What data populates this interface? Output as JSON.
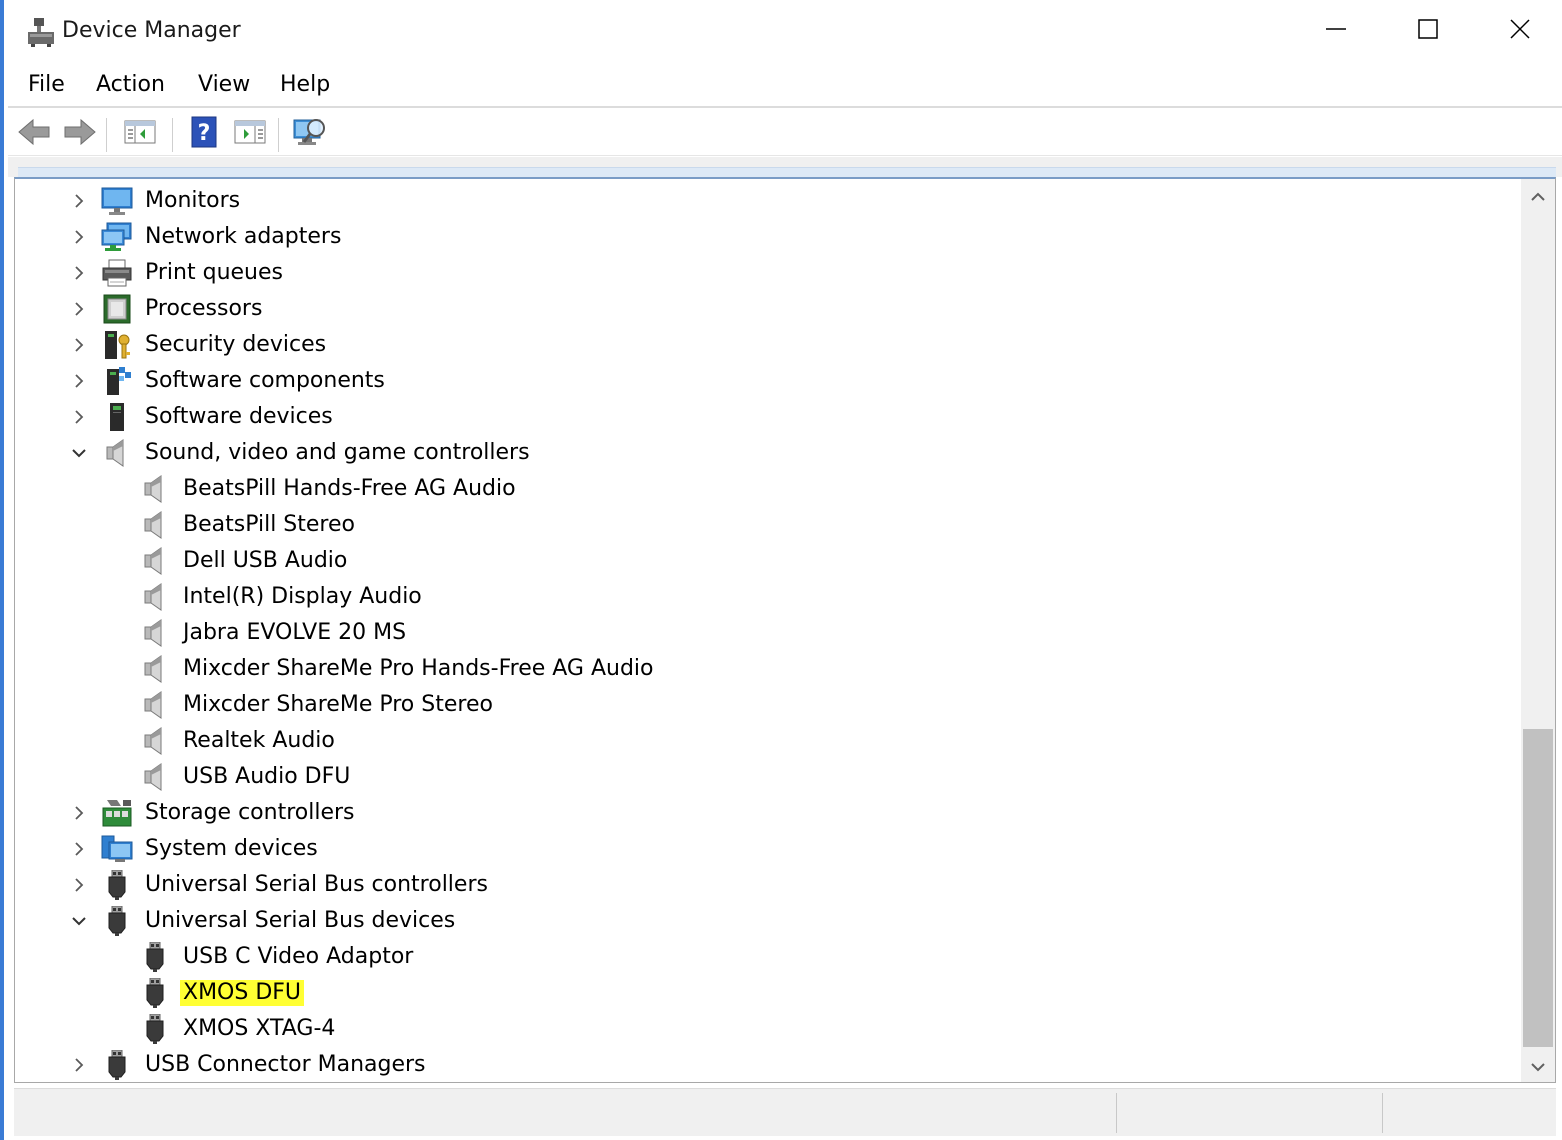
{
  "window": {
    "title": "Device Manager",
    "icon": "device-manager-icon",
    "controls": [
      "minimize-icon",
      "maximize-icon",
      "close-icon"
    ]
  },
  "menu": {
    "file": "File",
    "action": "Action",
    "view": "View",
    "help": "Help"
  },
  "toolbar": {
    "buttons": [
      "back-arrow-icon",
      "forward-arrow-icon",
      "show-hide-console-tree-icon",
      "help-icon",
      "properties-icon",
      "scan-hardware-icon"
    ]
  },
  "tree": {
    "rows": [
      {
        "label": "Monitors",
        "icon": "monitor-icon",
        "expander": "collapsed",
        "level": 1
      },
      {
        "label": "Network adapters",
        "icon": "network-adapter-icon",
        "expander": "collapsed",
        "level": 1
      },
      {
        "label": "Print queues",
        "icon": "printer-icon",
        "expander": "collapsed",
        "level": 1
      },
      {
        "label": "Processors",
        "icon": "processor-icon",
        "expander": "collapsed",
        "level": 1
      },
      {
        "label": "Security devices",
        "icon": "security-device-icon",
        "expander": "collapsed",
        "level": 1
      },
      {
        "label": "Software components",
        "icon": "software-component-icon",
        "expander": "collapsed",
        "level": 1
      },
      {
        "label": "Software devices",
        "icon": "software-device-icon",
        "expander": "collapsed",
        "level": 1
      },
      {
        "label": "Sound, video and game controllers",
        "icon": "speaker-icon",
        "expander": "expanded",
        "level": 1
      },
      {
        "label": "BeatsPill Hands-Free AG Audio",
        "icon": "speaker-icon",
        "level": 2
      },
      {
        "label": "BeatsPill Stereo",
        "icon": "speaker-icon",
        "level": 2
      },
      {
        "label": "Dell USB Audio",
        "icon": "speaker-icon",
        "level": 2
      },
      {
        "label": "Intel(R) Display Audio",
        "icon": "speaker-icon",
        "level": 2
      },
      {
        "label": "Jabra EVOLVE 20 MS",
        "icon": "speaker-icon",
        "level": 2
      },
      {
        "label": "Mixcder ShareMe Pro Hands-Free AG Audio",
        "icon": "speaker-icon",
        "level": 2
      },
      {
        "label": "Mixcder ShareMe Pro Stereo",
        "icon": "speaker-icon",
        "level": 2
      },
      {
        "label": "Realtek Audio",
        "icon": "speaker-icon",
        "level": 2
      },
      {
        "label": "USB Audio DFU",
        "icon": "speaker-icon",
        "level": 2
      },
      {
        "label": "Storage controllers",
        "icon": "storage-controller-icon",
        "expander": "collapsed",
        "level": 1
      },
      {
        "label": "System devices",
        "icon": "system-device-icon",
        "expander": "collapsed",
        "level": 1
      },
      {
        "label": "Universal Serial Bus controllers",
        "icon": "usb-plug-icon",
        "expander": "collapsed",
        "level": 1
      },
      {
        "label": "Universal Serial Bus devices",
        "icon": "usb-plug-icon",
        "expander": "expanded",
        "level": 1
      },
      {
        "label": "USB C Video Adaptor",
        "icon": "usb-plug-icon",
        "level": 2
      },
      {
        "label": "XMOS DFU",
        "icon": "usb-plug-icon",
        "level": 2,
        "highlighted": true
      },
      {
        "label": "XMOS XTAG-4",
        "icon": "usb-plug-icon",
        "level": 2
      },
      {
        "label": "USB Connector Managers",
        "icon": "usb-plug-icon",
        "expander": "collapsed",
        "level": 1
      }
    ]
  },
  "colors": {
    "highlight": "#ffff33",
    "accent": "#3a7bd5"
  }
}
